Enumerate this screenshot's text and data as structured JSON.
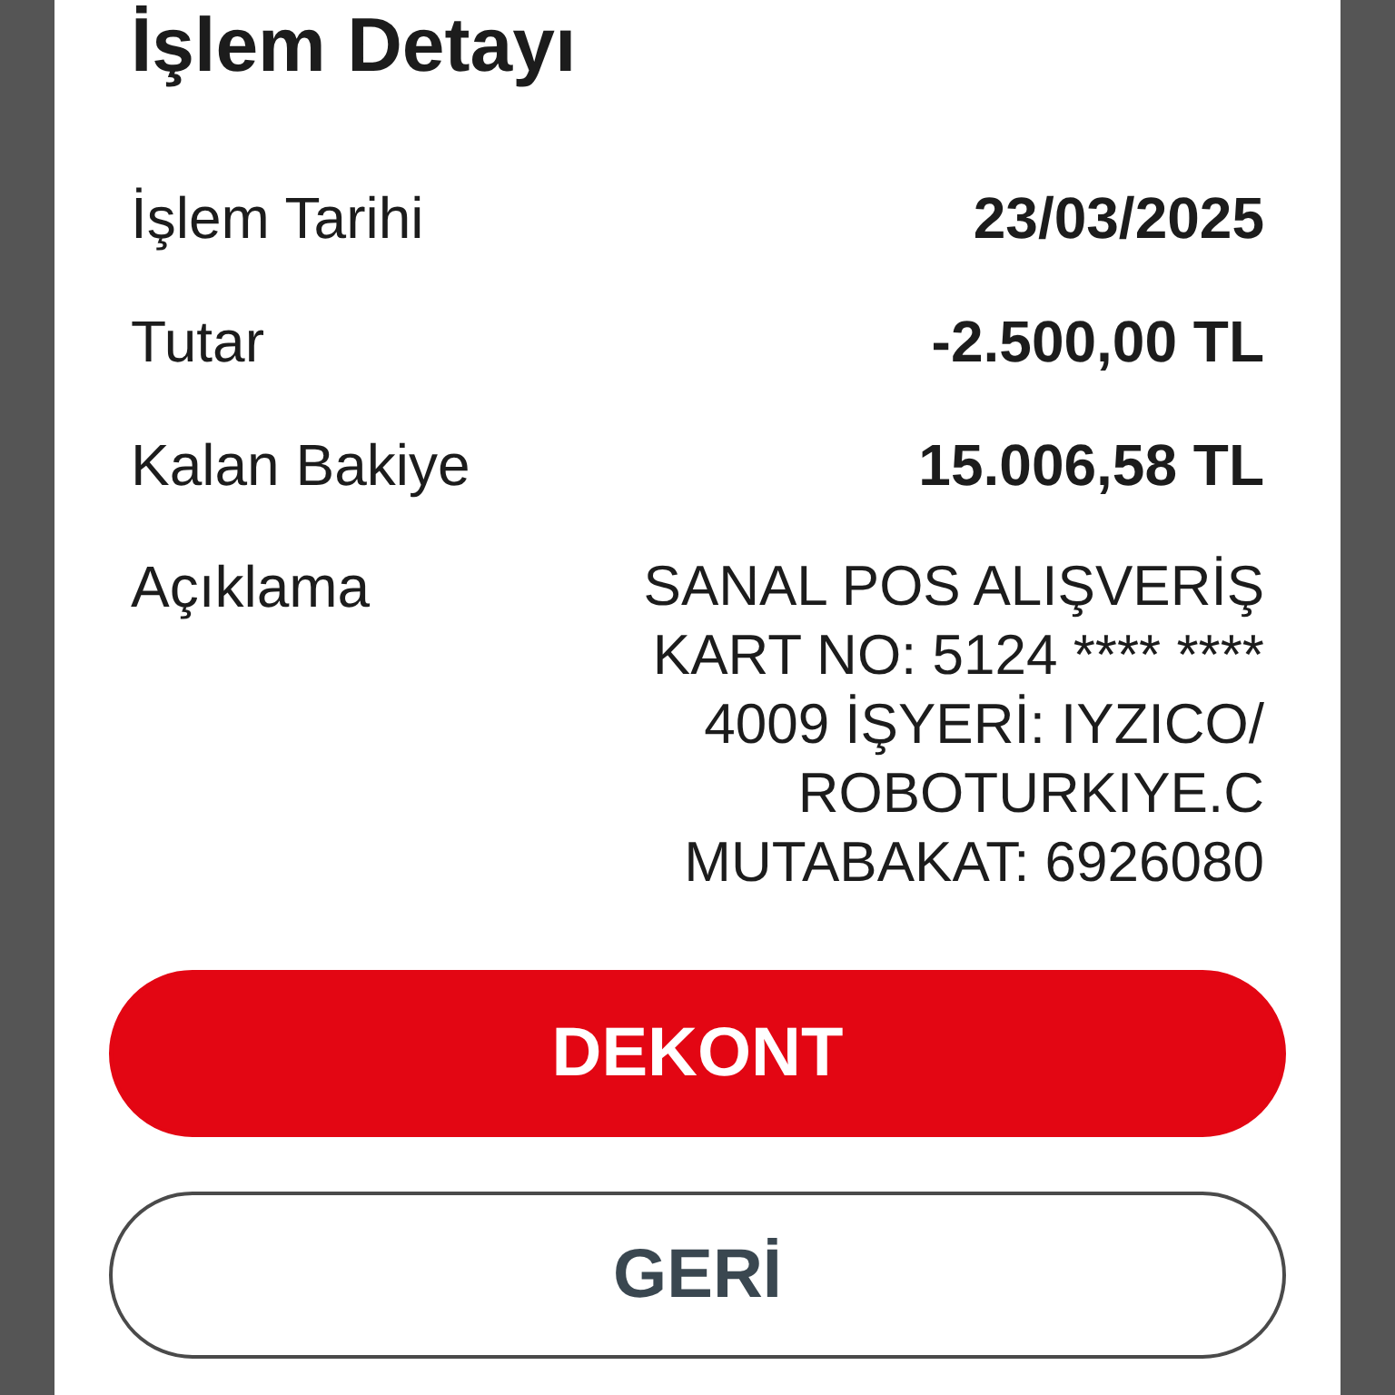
{
  "title": "İşlem Detayı",
  "rows": [
    {
      "label": "İşlem Tarihi",
      "value": "23/03/2025"
    },
    {
      "label": "Tutar",
      "value": "-2.500,00 TL"
    },
    {
      "label": "Kalan Bakiye",
      "value": "15.006,58 TL"
    }
  ],
  "description": {
    "label": "Açıklama",
    "lines": [
      "SANAL POS ALIŞVERİŞ",
      "KART NO: 5124 **** ****",
      "4009 İŞYERİ: IYZICO/",
      "ROBOTURKIYE.C",
      "MUTABAKAT: 6926080"
    ]
  },
  "buttons": [
    {
      "label": "DEKONT",
      "kind": "primary"
    },
    {
      "label": "GERİ",
      "kind": "secondary"
    }
  ]
}
